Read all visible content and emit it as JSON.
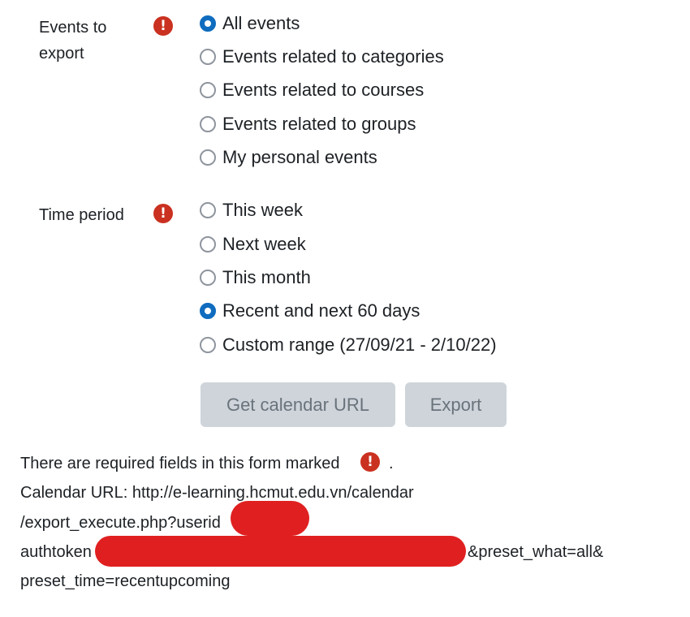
{
  "events_to_export": {
    "label_line1": "Events to",
    "label_line2": "export",
    "required_icon": "exclamation-icon",
    "options": [
      {
        "label": "All events",
        "checked": true
      },
      {
        "label": "Events related to categories",
        "checked": false
      },
      {
        "label": "Events related to courses",
        "checked": false
      },
      {
        "label": "Events related to groups",
        "checked": false
      },
      {
        "label": "My personal events",
        "checked": false
      }
    ]
  },
  "time_period": {
    "label": "Time period",
    "required_icon": "exclamation-icon",
    "options": [
      {
        "label": "This week",
        "checked": false
      },
      {
        "label": "Next week",
        "checked": false
      },
      {
        "label": "This month",
        "checked": false
      },
      {
        "label": "Recent and next 60 days",
        "checked": true
      },
      {
        "label": "Custom range (27/09/21 - 2/10/22)",
        "checked": false
      }
    ]
  },
  "buttons": {
    "get_url": "Get calendar URL",
    "export": "Export"
  },
  "footer": {
    "required_note_prefix": "There are required fields in this form marked",
    "required_note_suffix": ".",
    "url_line1": "Calendar URL: http://e-learning.hcmut.edu.vn/calendar",
    "url_line2": "/export_execute.php?userid",
    "url_line3_prefix": "authtoken",
    "url_line3_suffix": "&preset_what=all&",
    "url_line4": "preset_time=recentupcoming"
  },
  "colors": {
    "accent": "#0f6cbf",
    "required": "#ca3120",
    "redaction": "#e02020",
    "button_bg": "#ced4da"
  }
}
